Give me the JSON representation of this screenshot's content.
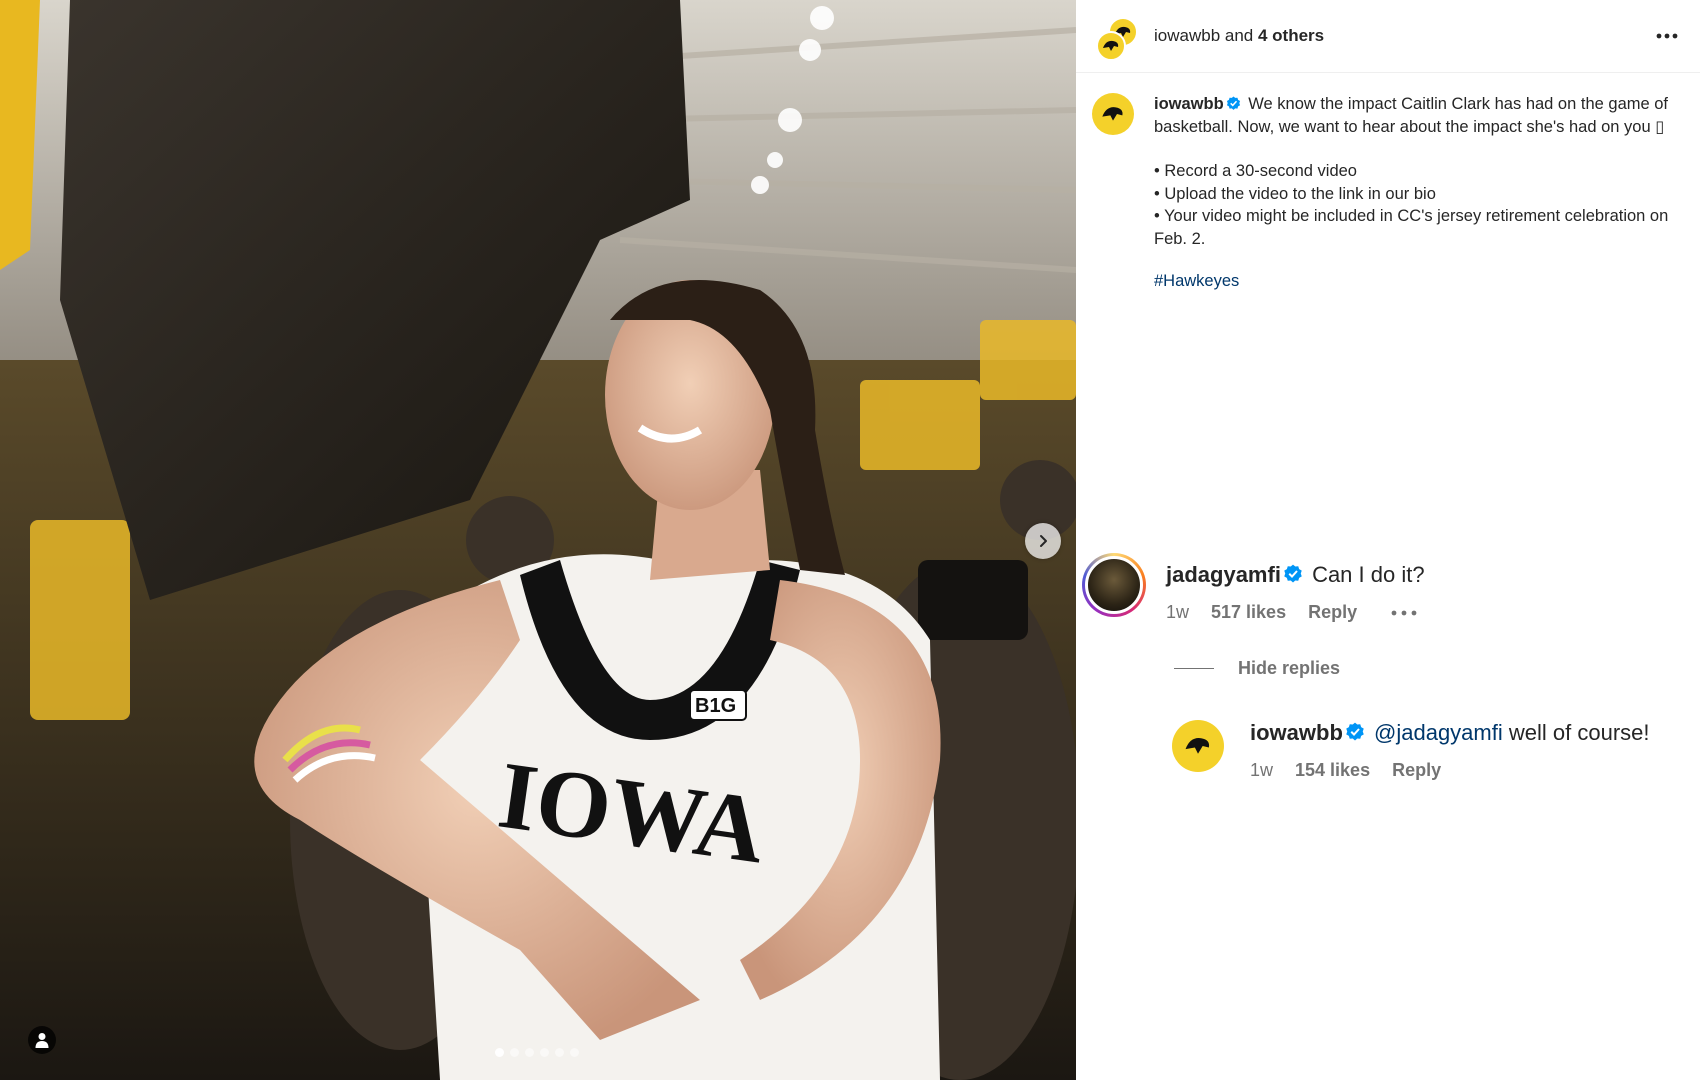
{
  "header": {
    "account": "iowawbb",
    "joiner": "and",
    "others": "4 others"
  },
  "caption": {
    "username": "iowawbb",
    "text_intro": "We know the impact Caitlin Clark has had on the game of basketball. Now, we want to hear about the impact she's had on you ▯",
    "bullets": "• Record a 30-second video\n• Upload the video to the link in our bio\n• Your video might be included in CC's jersey retirement celebration on Feb. 2.",
    "hashtag": "#Hawkeyes"
  },
  "comments": [
    {
      "username": "jadagyamfi",
      "text": "Can I do it?",
      "time": "1w",
      "likes": "517 likes",
      "reply": "Reply"
    }
  ],
  "hide_replies": "Hide replies",
  "reply": {
    "username": "iowawbb",
    "mention": "@jadagyamfi",
    "text": "well of course!",
    "time": "1w",
    "likes": "154 likes",
    "reply": "Reply"
  },
  "carousel": {
    "slides": 6,
    "active": 1
  },
  "colors": {
    "verified": "#0095f6",
    "link": "#00376b",
    "meta": "#737373",
    "hawkeye_gold": "#f4d12a"
  },
  "icons": [
    "verified-badge-icon",
    "more-options-icon",
    "chevron-right-icon",
    "user-tag-icon",
    "hawkeye-logo-icon"
  ]
}
